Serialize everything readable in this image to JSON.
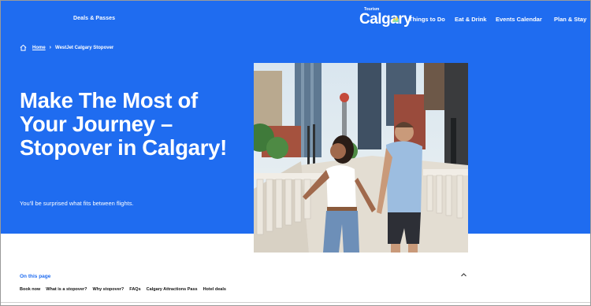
{
  "topbar": {
    "deals_label": "Deals & Passes",
    "logo_small": "Tourism",
    "logo_big": "Calgary",
    "nav": [
      "Things to Do",
      "Eat & Drink",
      "Events Calendar",
      "Plan & Stay"
    ]
  },
  "breadcrumb": {
    "home": "Home",
    "separator": "›",
    "current": "WestJet Calgary Stopover"
  },
  "hero": {
    "headline": "Make The Most of Your Journey – Stopover in Calgary!",
    "subtitle": "You'll be surprised what fits between flights."
  },
  "on_this_page": {
    "title": "On this page",
    "links": [
      "Book now",
      "What is a stopover?",
      "Why stopover?",
      "FAQs",
      "Calgary Attractions Pass",
      "Hotel deals"
    ]
  },
  "colors": {
    "brand_blue": "#1f6cf0",
    "white": "#ffffff"
  }
}
